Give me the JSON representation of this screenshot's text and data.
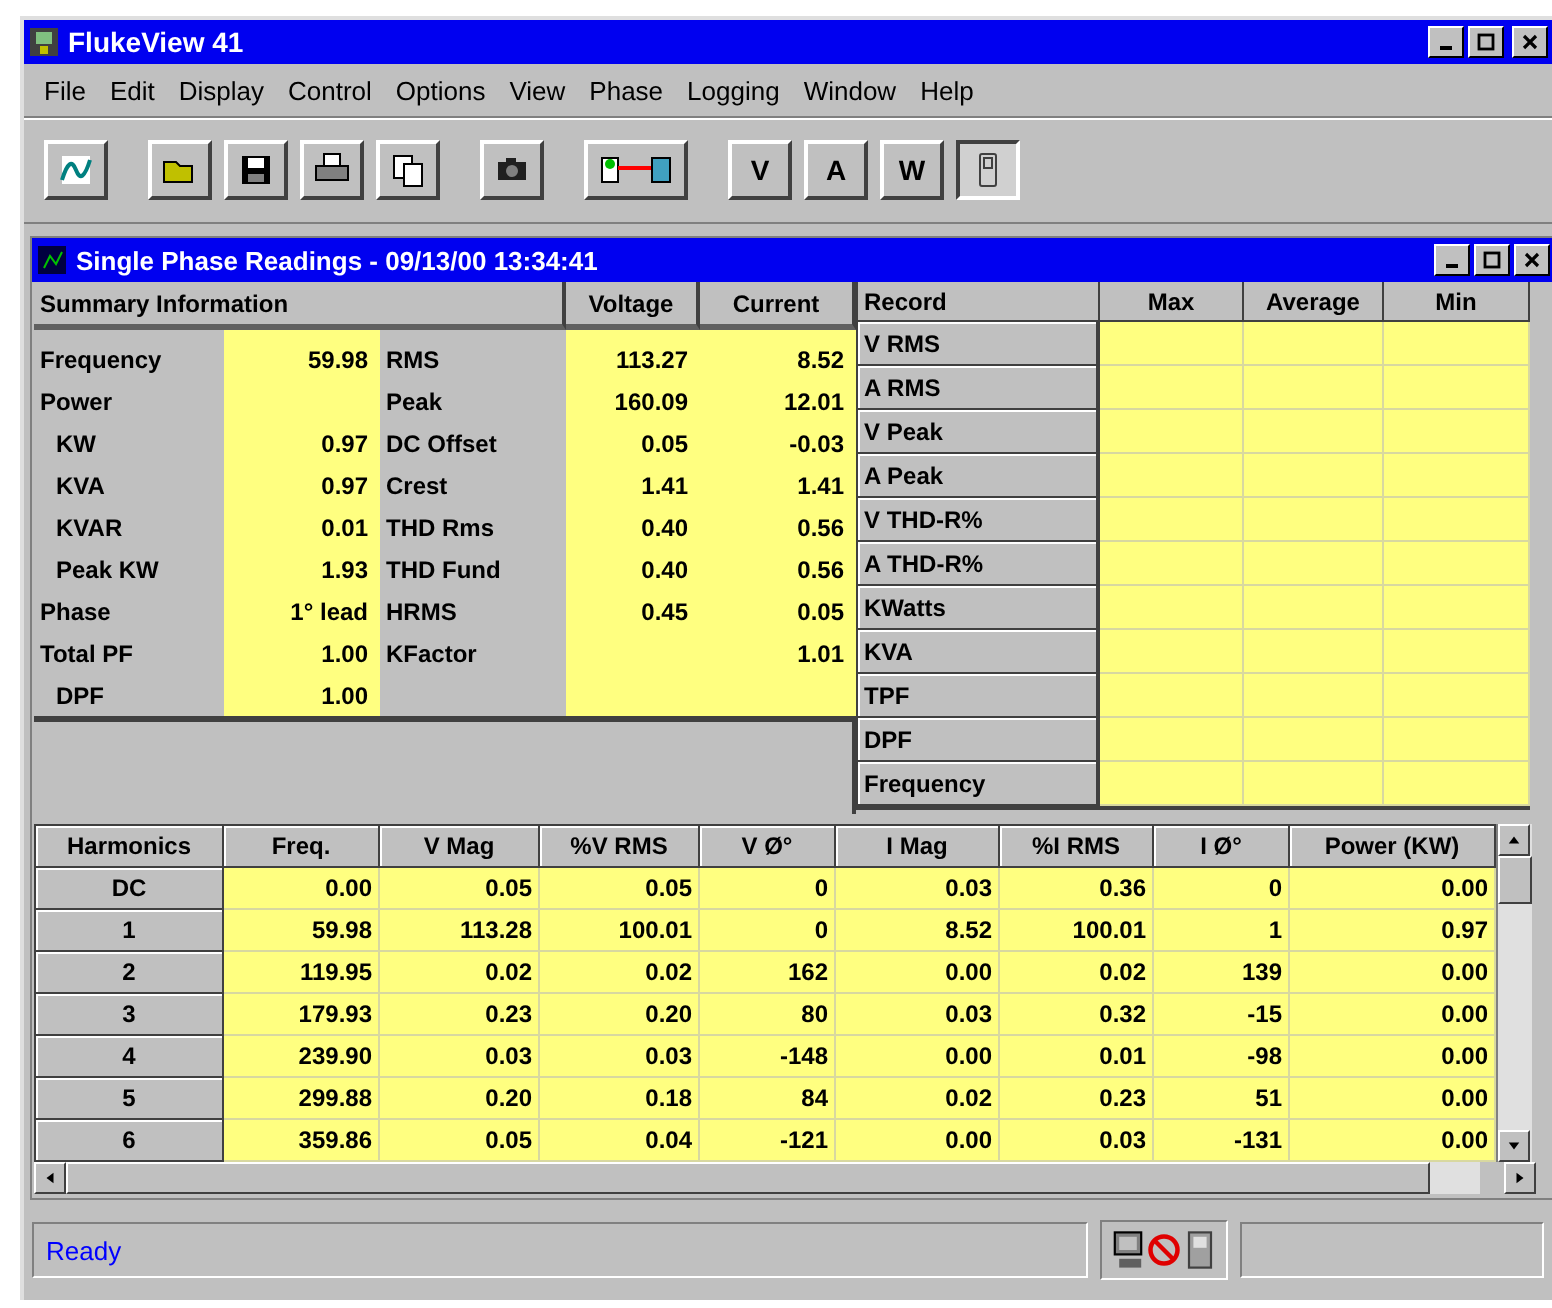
{
  "window": {
    "title": "FlukeView 41"
  },
  "menu": [
    "File",
    "Edit",
    "Display",
    "Control",
    "Options",
    "View",
    "Phase",
    "Logging",
    "Window",
    "Help"
  ],
  "toolbar": {
    "letter_buttons": [
      "V",
      "A",
      "W"
    ]
  },
  "child_window": {
    "title": "Single Phase Readings - 09/13/00 13:34:41",
    "summary": {
      "heading": "Summary Information",
      "columns": [
        "Voltage",
        "Current"
      ],
      "left_rows": [
        {
          "label": "Frequency",
          "value": "59.98"
        },
        {
          "label": "Power",
          "children": [
            {
              "label": "KW",
              "value": "0.97"
            },
            {
              "label": "KVA",
              "value": "0.97"
            },
            {
              "label": "KVAR",
              "value": "0.01"
            },
            {
              "label": "Peak KW",
              "value": "1.93"
            }
          ]
        },
        {
          "label": "Phase",
          "value": "1° lead"
        },
        {
          "label": "Total PF",
          "value": "1.00",
          "children": [
            {
              "label": "DPF",
              "value": "1.00"
            }
          ]
        }
      ],
      "right_rows": [
        {
          "label": "RMS",
          "voltage": "113.27",
          "current": "8.52"
        },
        {
          "label": "Peak",
          "voltage": "160.09",
          "current": "12.01"
        },
        {
          "label": "DC Offset",
          "voltage": "0.05",
          "current": "-0.03"
        },
        {
          "label": "Crest",
          "voltage": "1.41",
          "current": "1.41"
        },
        {
          "label": "THD Rms",
          "voltage": "0.40",
          "current": "0.56"
        },
        {
          "label": "THD Fund",
          "voltage": "0.40",
          "current": "0.56"
        },
        {
          "label": "HRMS",
          "voltage": "0.45",
          "current": "0.05"
        },
        {
          "label": "KFactor",
          "current": "1.01"
        }
      ]
    },
    "record": {
      "columns": [
        "Record",
        "Max",
        "Average",
        "Min"
      ],
      "rows": [
        "V RMS",
        "A RMS",
        "V Peak",
        "A Peak",
        "V THD-R%",
        "A THD-R%",
        "KWatts",
        "KVA",
        "TPF",
        "DPF",
        "Frequency"
      ]
    },
    "harmonics": {
      "columns": [
        "Harmonics",
        "Freq.",
        "V Mag",
        "%V RMS",
        "V Ø°",
        "I Mag",
        "%I RMS",
        "I Ø°",
        "Power (KW)"
      ],
      "rows": [
        [
          "DC",
          "0.00",
          "0.05",
          "0.05",
          "0",
          "0.03",
          "0.36",
          "0",
          "0.00"
        ],
        [
          "1",
          "59.98",
          "113.28",
          "100.01",
          "0",
          "8.52",
          "100.01",
          "1",
          "0.97"
        ],
        [
          "2",
          "119.95",
          "0.02",
          "0.02",
          "162",
          "0.00",
          "0.02",
          "139",
          "0.00"
        ],
        [
          "3",
          "179.93",
          "0.23",
          "0.20",
          "80",
          "0.03",
          "0.32",
          "-15",
          "0.00"
        ],
        [
          "4",
          "239.90",
          "0.03",
          "0.03",
          "-148",
          "0.00",
          "0.01",
          "-98",
          "0.00"
        ],
        [
          "5",
          "299.88",
          "0.20",
          "0.18",
          "84",
          "0.02",
          "0.23",
          "51",
          "0.00"
        ],
        [
          "6",
          "359.86",
          "0.05",
          "0.04",
          "-121",
          "0.00",
          "0.03",
          "-131",
          "0.00"
        ]
      ]
    }
  },
  "status_bar": {
    "text": "Ready"
  }
}
